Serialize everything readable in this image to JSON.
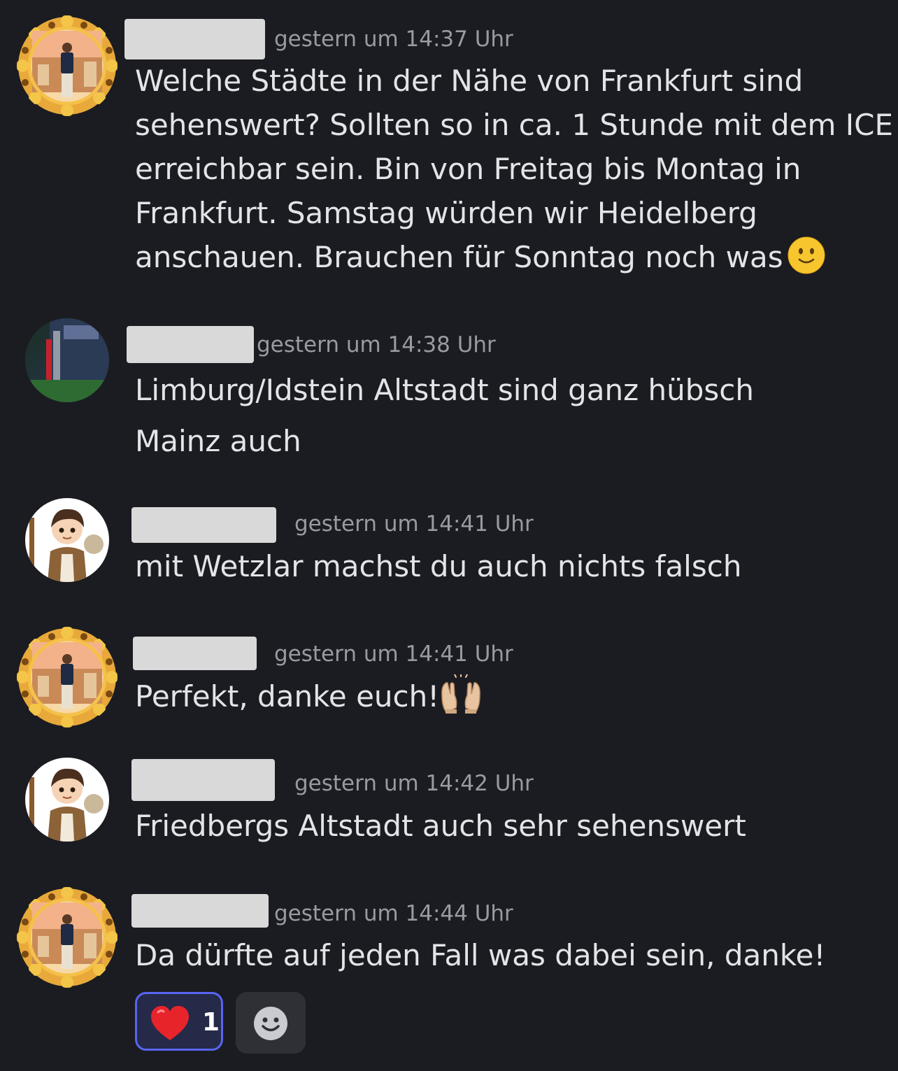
{
  "messages": [
    {
      "avatar": "sunflower-frame-avatar",
      "time": "gestern um 14:37 Uhr",
      "lines": [
        "Welche Städte in der Nähe von Frankfurt sind",
        "sehenswert? Sollten so in ca. 1 Stunde mit dem ICE",
        "erreichbar sein. Bin von Freitag bis Montag in",
        "Frankfurt. Samstag würden wir Heidelberg",
        "anschauen. Brauchen für Sonntag noch was"
      ],
      "trailing_emoji": "slightly-smiling-face-icon"
    },
    {
      "avatar": "stadium-avatar",
      "time": "gestern um 14:38 Uhr",
      "lines": [
        "Limburg/Idstein Altstadt sind ganz hübsch",
        "Mainz auch"
      ]
    },
    {
      "avatar": "hiker-cartoon-avatar",
      "time": "gestern um 14:41 Uhr",
      "lines": [
        "mit Wetzlar machst du auch nichts falsch"
      ]
    },
    {
      "avatar": "sunflower-frame-avatar",
      "time": "gestern um 14:41 Uhr",
      "lines": [
        "Perfekt, danke euch!"
      ],
      "trailing_emoji": "raising-hands-icon"
    },
    {
      "avatar": "hiker-cartoon-avatar",
      "time": "gestern um 14:42 Uhr",
      "lines": [
        "Friedbergs Altstadt auch sehr sehenswert"
      ]
    },
    {
      "avatar": "sunflower-frame-avatar",
      "time": "gestern um 14:44 Uhr",
      "lines": [
        "Da dürfte auf jeden Fall was dabei sein, danke!"
      ]
    }
  ],
  "reactions": [
    {
      "emoji": "red-heart-icon",
      "count": "1",
      "selected": true
    }
  ],
  "add_reaction": {
    "icon": "smiley-add-reaction-icon"
  },
  "colors": {
    "background": "#1b1c21",
    "text": "#e3e4e8",
    "timestamp": "#989aa4",
    "redaction": "#d9d9d9",
    "reaction_selected_border": "#5865f2",
    "reaction_selected_bg": "#252a48"
  }
}
